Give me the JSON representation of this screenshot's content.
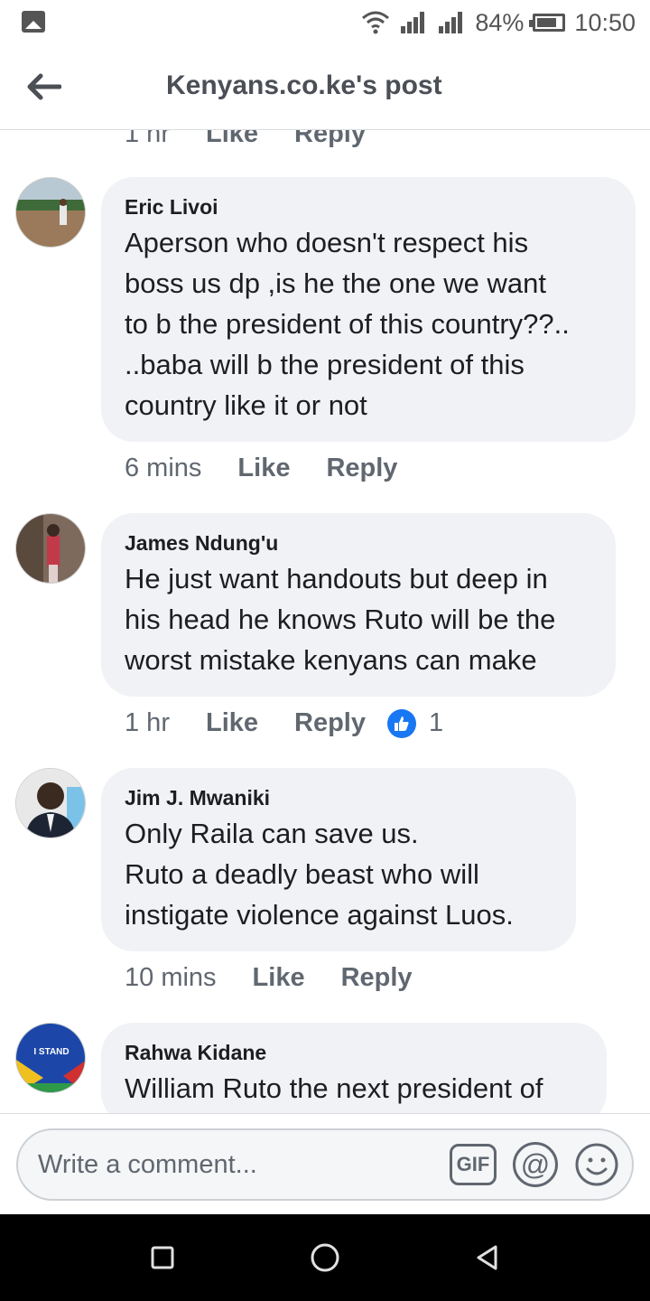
{
  "status_bar": {
    "battery": "84%",
    "time": "10:50"
  },
  "header": {
    "title": "Kenyans.co.ke's post"
  },
  "previous_comment": {
    "time": "1 hr",
    "like": "Like",
    "reply": "Reply"
  },
  "comments": [
    {
      "author": "Eric Livoi",
      "text": "Aperson who doesn't respect his\nboss us dp ,is he the one we want\nto b the president of this country??..\n..baba will b the president of this\ncountry like it or not",
      "time": "6 mins",
      "like": "Like",
      "reply": "Reply"
    },
    {
      "author": "James Ndung'u",
      "text": "He just want handouts but deep in\nhis head he knows Ruto will be the\nworst mistake kenyans can make",
      "time": "1 hr",
      "like": "Like",
      "reply": "Reply",
      "reactions": "1"
    },
    {
      "author": "Jim J. Mwaniki",
      "text": "Only Raila can save us.\nRuto a deadly beast who will\ninstigate violence against Luos.",
      "time": "10 mins",
      "like": "Like",
      "reply": "Reply"
    },
    {
      "author": "Rahwa Kidane",
      "text": "William Ruto the next president of",
      "avatar_caption": "I STAND"
    }
  ],
  "composer": {
    "placeholder": "Write a comment...",
    "gif_label": "GIF",
    "at_label": "@"
  },
  "icons": {
    "back": "arrow-left-icon",
    "wifi": "wifi-icon",
    "signal": "signal-icon",
    "battery": "battery-icon",
    "like_reaction": "thumbs-up-icon",
    "emoji": "smiley-icon",
    "nav_recents": "square-icon",
    "nav_home": "circle-icon",
    "nav_back": "triangle-back-icon"
  },
  "colors": {
    "accent": "#1877f2",
    "bubble": "#f0f2f5",
    "muted": "#606770"
  }
}
